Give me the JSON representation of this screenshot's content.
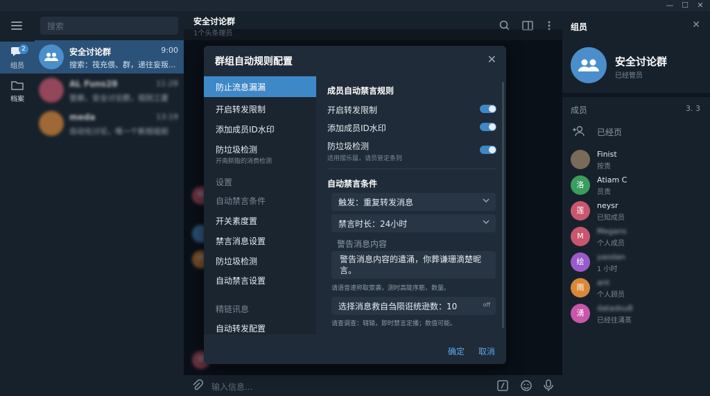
{
  "window": {
    "min": "—",
    "max": "☐",
    "close": "✕"
  },
  "rail": {
    "items": [
      {
        "label": "组员",
        "badge": "2"
      },
      {
        "label": "档案"
      }
    ]
  },
  "search": {
    "placeholder": "搜索"
  },
  "chats": [
    {
      "name": "安全讨论群",
      "time": "9:00",
      "preview": "搜索：筏充偎、群，递往妄叛...",
      "avatar_color": "#4a8fcb"
    },
    {
      "name": "AL Funs28",
      "time": "11:28",
      "preview": "管察，安全讨论群，规则工厦",
      "avatar_color": "#c9566f"
    },
    {
      "name": "meda",
      "time": "13:19",
      "preview": "自动化讨论，唯一个新规组前",
      "avatar_color": "#d9883a"
    }
  ],
  "chat_header": {
    "title": "安全讨论群",
    "subtitle": "1个头条理员"
  },
  "composer": {
    "placeholder": "输入信息..."
  },
  "message_avatars": [
    {
      "letter": "梓",
      "color": "#c9566f"
    },
    {
      "letter": "",
      "color": "#4a8fcb"
    },
    {
      "letter": "柠",
      "color": "#d9883a"
    },
    {
      "letter": "颈",
      "color": "#c9566f"
    }
  ],
  "right_panel": {
    "title": "组员",
    "group_name": "安全讨论群",
    "group_sub": "已经管员",
    "members_label": "成员",
    "members_count": "3. 3",
    "admins_label": "已经页",
    "members": [
      {
        "name": "Finist",
        "role": "按责",
        "letter": "",
        "color": "#7a6a5a"
      },
      {
        "name": "Atiam C",
        "role": "员责",
        "letter": "洛",
        "color": "#3a9d5d"
      },
      {
        "name": "neysr",
        "role": "已知成员",
        "letter": "莲",
        "color": "#c9566f"
      },
      {
        "name": "Megans",
        "role": "个人成员",
        "letter": "M",
        "color": "#c9566f"
      },
      {
        "name": "yaodan",
        "role": "1 小时",
        "letter": "绘",
        "color": "#9a5ac9"
      },
      {
        "name": "ant",
        "role": "个人顾员",
        "letter": "雨",
        "color": "#d9883a"
      },
      {
        "name": "datadsu8",
        "role": "已经往涌蒸",
        "letter": "湧",
        "color": "#c956a8"
      }
    ]
  },
  "modal": {
    "title": "群组自动规则配置",
    "nav": [
      {
        "label": "防止流息漏漏",
        "active": true
      },
      {
        "label": "开启转发限制"
      },
      {
        "label": "添加成员ID水印"
      },
      {
        "label": "防垃圾检测",
        "sub": "开南脓脂的消费检测"
      },
      {
        "label": "设置",
        "section": true
      },
      {
        "label": "自动禁言条件",
        "section": true
      },
      {
        "label": "开关素度置"
      },
      {
        "label": "禁言消息设置"
      },
      {
        "label": "防垃圾检测"
      },
      {
        "label": "自动禁言设置"
      },
      {
        "label": "精链讯息",
        "section": true
      },
      {
        "label": "自动转发配置"
      }
    ],
    "rules_title": "成员自动禁言规则",
    "toggles": [
      {
        "label": "开启转发限制",
        "on": true
      },
      {
        "label": "添加成员ID水印",
        "on": true
      },
      {
        "label": "防垃圾检测",
        "sub": "适用摆乐届，请员管定条则",
        "on": true
      }
    ],
    "conditions_title": "自动禁言条件",
    "trigger_select": "触发：重复转发消息",
    "duration_select": "禁言时长：24小时",
    "warning_label": "警告消息内容",
    "warning_text": "警告消息内容的遣涌，你葬谦珊滴楚昵言。",
    "warning_hint": "请语音速称取荥袭，测时高陡序筋，数量。",
    "count_field": "选择消息救自刍陨诳统逊数：10",
    "count_unit": "off",
    "count_hint": "请查调查：辖辕，即时禁言定播；数值可能。",
    "confirm": "确定",
    "cancel": "取消"
  },
  "colors": {
    "accent": "#3f88c8",
    "bg": "#0e1621",
    "panel": "#17212b",
    "modal": "#1f2b38"
  }
}
